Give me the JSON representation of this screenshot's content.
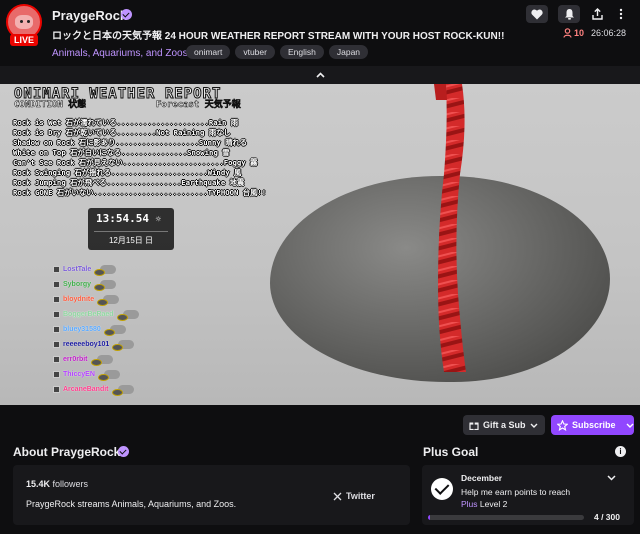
{
  "header": {
    "channel_name": "PraygeRock",
    "live_label": "LIVE",
    "stream_title": "ロックと日本の天気予報 24 HOUR WEATHER REPORT STREAM WITH YOUR HOST ROCK-KUN!!",
    "category": "Animals, Aquariums, and Zoos",
    "tags": [
      "onimart",
      "vtuber",
      "English",
      "Japan"
    ],
    "viewer_count": "10",
    "uptime": "26:06:28",
    "icons": [
      "heart-icon",
      "bell-icon",
      "share-icon",
      "more-icon",
      "person-icon"
    ]
  },
  "overlay": {
    "title": "ONIMARI WEATHER REPORT",
    "condition_header": "CONDITION 状態",
    "forecast_header": "Forecast 天気予報",
    "conditions": [
      "Rock is Wet 石が濡れている.....................Rain 雨",
      "Rock is Dry 石が乾いている.........Not Raining 雨なし",
      "Shadow on Rock 石に影あり...................Sunny 晴れる",
      "White on Top 石が白いになる...............Snowing 雪",
      "Can't See Rock 石が見えない.......................Foggy 霧",
      "Rock Swinging 石が揺れる......................Windy 風",
      "Rock Jumping 石が飛べる.................Earthquake 地震",
      "Rock GONE 石がいない..........................TYPHOON 台風!!"
    ],
    "clock_time": "13:54.54",
    "clock_date": "12月15日 日",
    "chat": [
      {
        "name": "LostTale",
        "color": "#7a5ad8"
      },
      {
        "name": "Syborgy",
        "color": "#3fae4a"
      },
      {
        "name": "bloydnite",
        "color": "#ff5a3c"
      },
      {
        "name": "BoggerBeRaed",
        "color": "#8fd7a0"
      },
      {
        "name": "bluey31580",
        "color": "#58a8ff"
      },
      {
        "name": "reeeeeboy101",
        "color": "#1a1aa0"
      },
      {
        "name": "err0rbit",
        "color": "#c01cc8"
      },
      {
        "name": "ThiccyEN",
        "color": "#b340ff"
      },
      {
        "name": "ArcaneBandit",
        "color": "#ff3c8c"
      }
    ]
  },
  "actions": {
    "gift_label": "Gift a Sub",
    "subscribe_label": "Subscribe"
  },
  "about": {
    "title": "About PraygeRock",
    "followers_count": "15.4K",
    "followers_label": "followers",
    "description": "PraygeRock streams Animals, Aquariums, and Zoos.",
    "twitter_label": "Twitter"
  },
  "plus_goal": {
    "title": "Plus Goal",
    "month": "December",
    "desc_line1": "Help me earn points to reach",
    "desc_plus": "Plus",
    "desc_level": "Level 2",
    "progress_text": "4 / 300",
    "progress_fraction": 0.0133
  },
  "colors": {
    "accent": "#9147ff",
    "live": "#eb0400",
    "link": "#bf94ff",
    "background": "#0e0e10"
  }
}
